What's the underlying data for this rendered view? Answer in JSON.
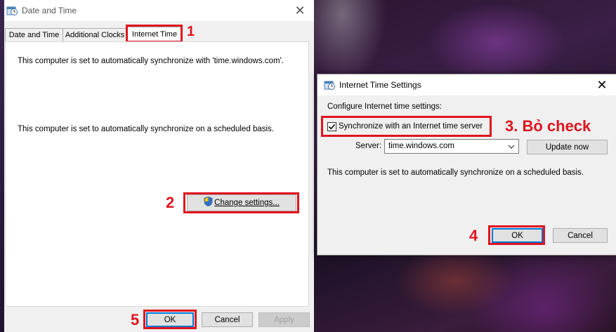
{
  "main_dialog": {
    "title": "Date and Time",
    "close_glyph": "✕",
    "tabs": [
      {
        "label": "Date and Time"
      },
      {
        "label": "Additional Clocks"
      },
      {
        "label": "Internet Time"
      }
    ],
    "sync_text": "This computer is set to automatically synchronize with 'time.windows.com'.",
    "schedule_text": "This computer is set to automatically synchronize on a scheduled basis.",
    "change_settings_label": "Change settings...",
    "ok_label": "OK",
    "cancel_label": "Cancel",
    "apply_label": "Apply"
  },
  "settings_dialog": {
    "title": "Internet Time Settings",
    "close_glyph": "✕",
    "configure_label": "Configure Internet time settings:",
    "sync_checkbox_label": "Synchronize with an Internet time server",
    "sync_checked": true,
    "server_label": "Server:",
    "server_value": "time.windows.com",
    "update_now_label": "Update now",
    "info_text": "This computer is set to automatically synchronize on a scheduled basis.",
    "ok_label": "OK",
    "cancel_label": "Cancel"
  },
  "annotations": {
    "step1": "1",
    "step2": "2",
    "step3": "3. Bỏ check",
    "step4": "4",
    "step5": "5"
  },
  "colors": {
    "annotation_red": "#e0141e",
    "accent_blue": "#0078d7"
  }
}
